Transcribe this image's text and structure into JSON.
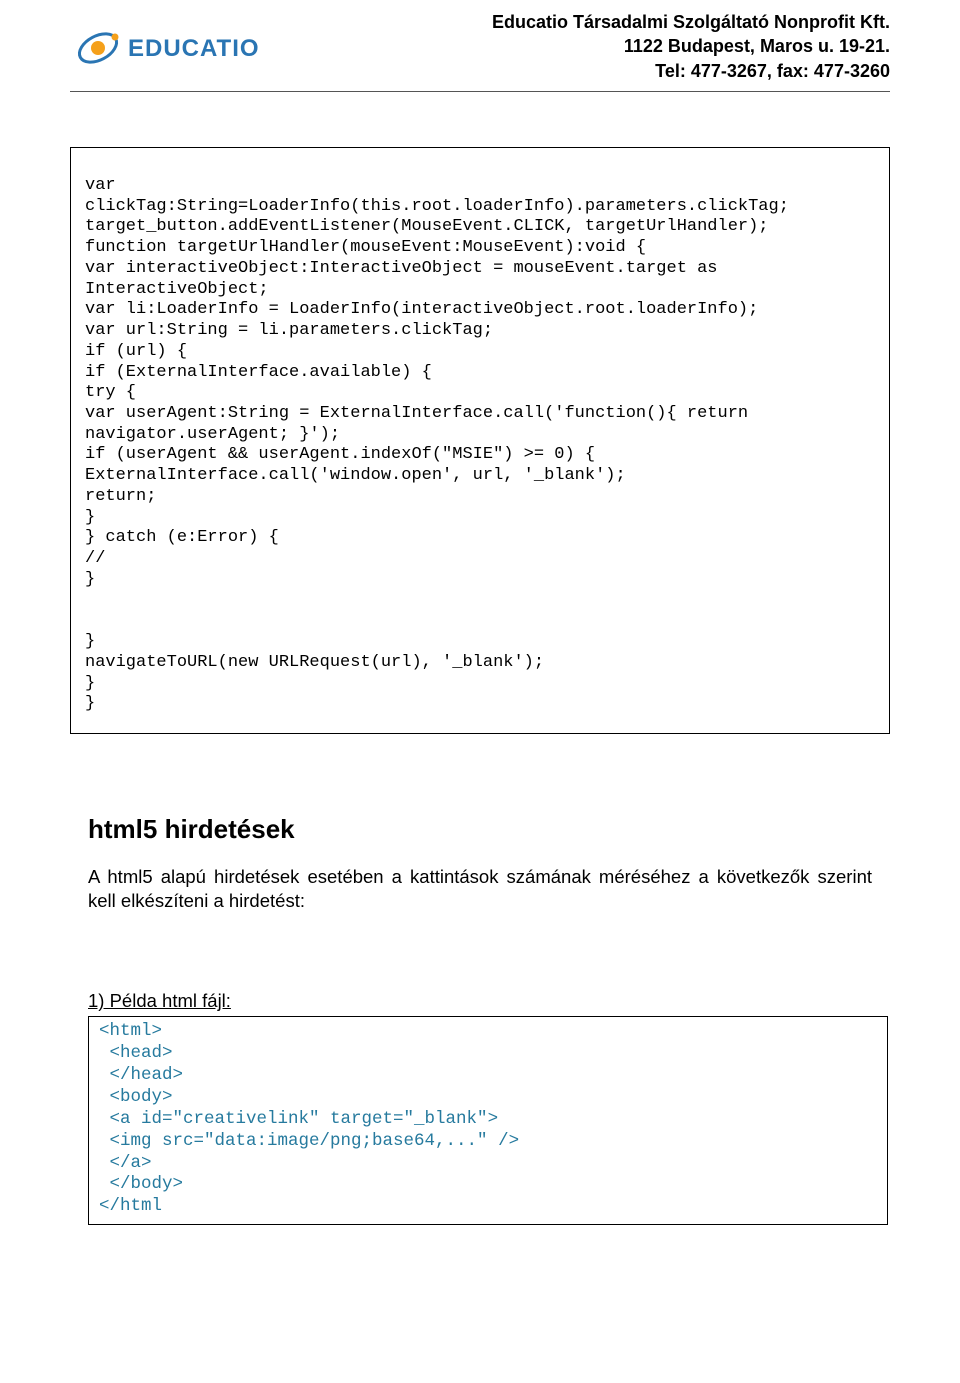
{
  "header": {
    "company_name": "Educatio Társadalmi Szolgáltató Nonprofit Kft.",
    "address": "1122 Budapest, Maros u. 19-21.",
    "phone": "Tel: 477-3267, fax: 477-3260",
    "logo_text": "EDUCATIO"
  },
  "codeblock1": "var\nclickTag:String=LoaderInfo(this.root.loaderInfo).parameters.clickTag;\ntarget_button.addEventListener(MouseEvent.CLICK, targetUrlHandler);\nfunction targetUrlHandler(mouseEvent:MouseEvent):void {\nvar interactiveObject:InteractiveObject = mouseEvent.target as\nInteractiveObject;\nvar li:LoaderInfo = LoaderInfo(interactiveObject.root.loaderInfo);\nvar url:String = li.parameters.clickTag;\nif (url) {\nif (ExternalInterface.available) {\ntry {\nvar userAgent:String = ExternalInterface.call('function(){ return\nnavigator.userAgent; }');\nif (userAgent && userAgent.indexOf(\"MSIE\") >= 0) {\nExternalInterface.call('window.open', url, '_blank');\nreturn;\n}\n} catch (e:Error) {\n//\n}\n\n\n}\nnavigateToURL(new URLRequest(url), '_blank');\n}\n}",
  "section": {
    "title": "html5 hirdetések",
    "paragraph": "A html5 alapú hirdetések esetében a kattintások számának méréséhez a következők szerint kell elkészíteni a hirdetést:",
    "example_label": "1)  Példa html fájl:"
  },
  "codeblock2": "<html>\n <head>\n </head>\n <body>\n <a id=\"creativelink\" target=\"_blank\">\n <img src=\"data:image/png;base64,...\" />\n </a>\n </body>\n</html"
}
